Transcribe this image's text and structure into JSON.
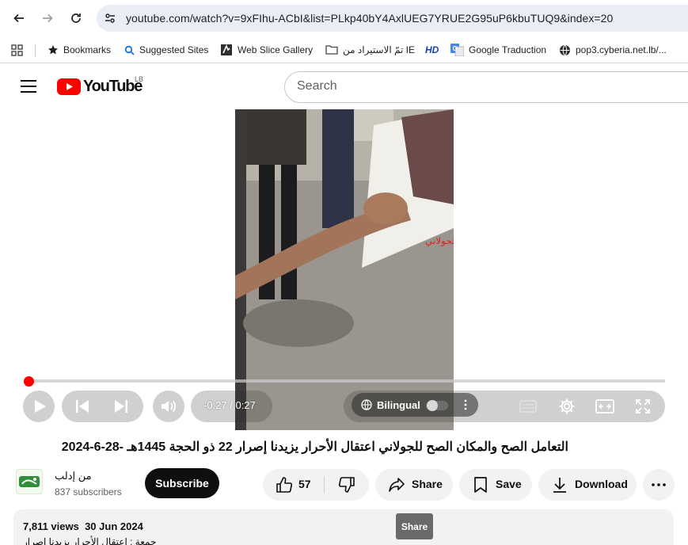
{
  "browser": {
    "url": "youtube.com/watch?v=9xFIhu-ACbI&list=PLkp40bY4AxlUEG7YRUE2G95uP6kbuTUQ9&index=20",
    "bookmarks": [
      {
        "label": "Bookmarks",
        "icon": "star-icon"
      },
      {
        "label": "Suggested Sites",
        "icon": "search-icon"
      },
      {
        "label": "Web Slice Gallery",
        "icon": "web-slice-icon"
      },
      {
        "label": "تمّ الاستيراد من IE",
        "icon": "folder-icon"
      },
      {
        "label": "",
        "icon": "hd-icon"
      },
      {
        "label": "Google Traduction",
        "icon": "translate-icon"
      },
      {
        "label": "pop3.cyberia.net.lb/...",
        "icon": "globe-icon"
      }
    ],
    "hd_label": "HD"
  },
  "masthead": {
    "logo_text": "YouTube",
    "country_code": "LB",
    "search_placeholder": "Search"
  },
  "player": {
    "time": "-0:27 / 0:27",
    "progress": 0.0,
    "subtitle_mode": "Bilingual",
    "sign_text": "سقط الجولاني"
  },
  "video": {
    "title": "التعامل الصح والمكان الصح للجولاني اعتقال الأحرار يزيدنا إصرار 22 ذو الحجة 1445هـ -28-6-2024",
    "channel": "من إدلب",
    "subscribers": "837 subscribers",
    "subscribe_label": "Subscribe",
    "likes": "57",
    "share_label": "Share",
    "save_label": "Save",
    "download_label": "Download",
    "views": "7,811 views",
    "date": "30 Jun 2024",
    "description_snippet": "جمعة : اعتقال الأحرار يزيدنا إصرار",
    "tooltip": "Share"
  },
  "colors": {
    "accent": "#ff0000",
    "chrome_bg": "#e9eef6"
  }
}
